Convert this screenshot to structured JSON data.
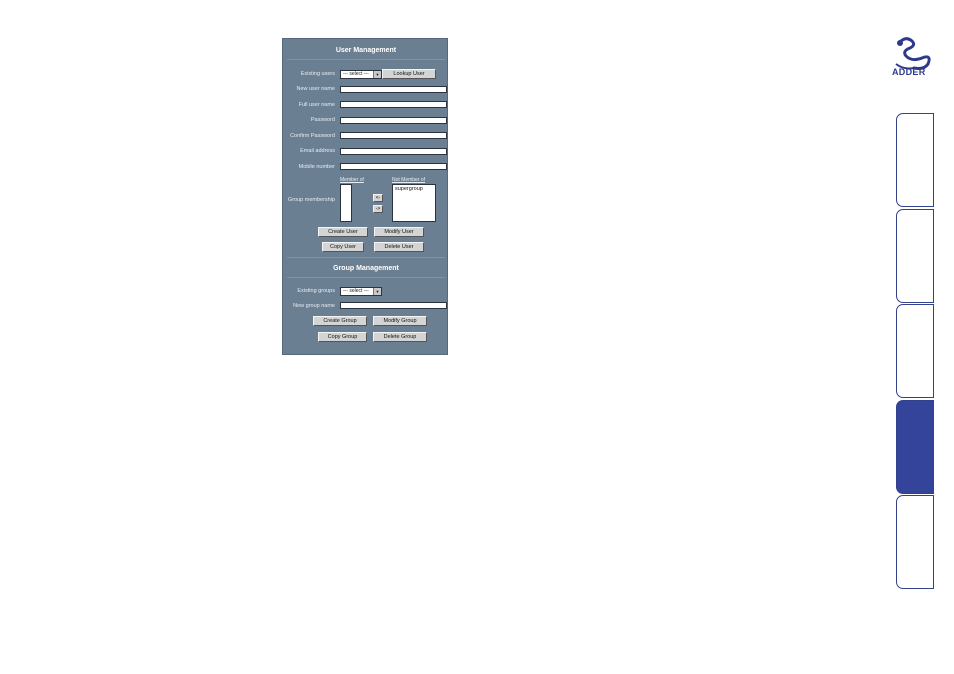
{
  "user_mgmt": {
    "title": "User Management",
    "existing_users_label": "Existing users",
    "existing_users_value": "--- select ---",
    "lookup_button": "Lookup User",
    "fields": [
      {
        "label": "New user name",
        "value": ""
      },
      {
        "label": "Full user name",
        "value": ""
      },
      {
        "label": "Password",
        "value": ""
      },
      {
        "label": "Confirm Password",
        "value": ""
      },
      {
        "label": "Email address",
        "value": ""
      },
      {
        "label": "Mobile number",
        "value": ""
      }
    ],
    "group_membership_label": "Group membership",
    "member_of_label": "Member of",
    "not_member_of_label": "Not Member of",
    "not_member_items": [
      "supergroup"
    ],
    "move_left": "<-",
    "move_right": "->",
    "buttons": {
      "create": "Create User",
      "modify": "Modify User",
      "copy": "Copy User",
      "delete": "Delete User"
    }
  },
  "group_mgmt": {
    "title": "Group Management",
    "existing_groups_label": "Existing groups",
    "existing_groups_value": "--- select ---",
    "new_group_label": "New group name",
    "new_group_value": "",
    "buttons": {
      "create": "Create Group",
      "modify": "Modify Group",
      "copy": "Copy Group",
      "delete": "Delete Group"
    }
  },
  "logo": {
    "text": "ADDER"
  },
  "colors": {
    "brand": "#34449a",
    "panel": "#6b7f93"
  },
  "side_tabs": {
    "count": 5,
    "active_index": 3
  }
}
